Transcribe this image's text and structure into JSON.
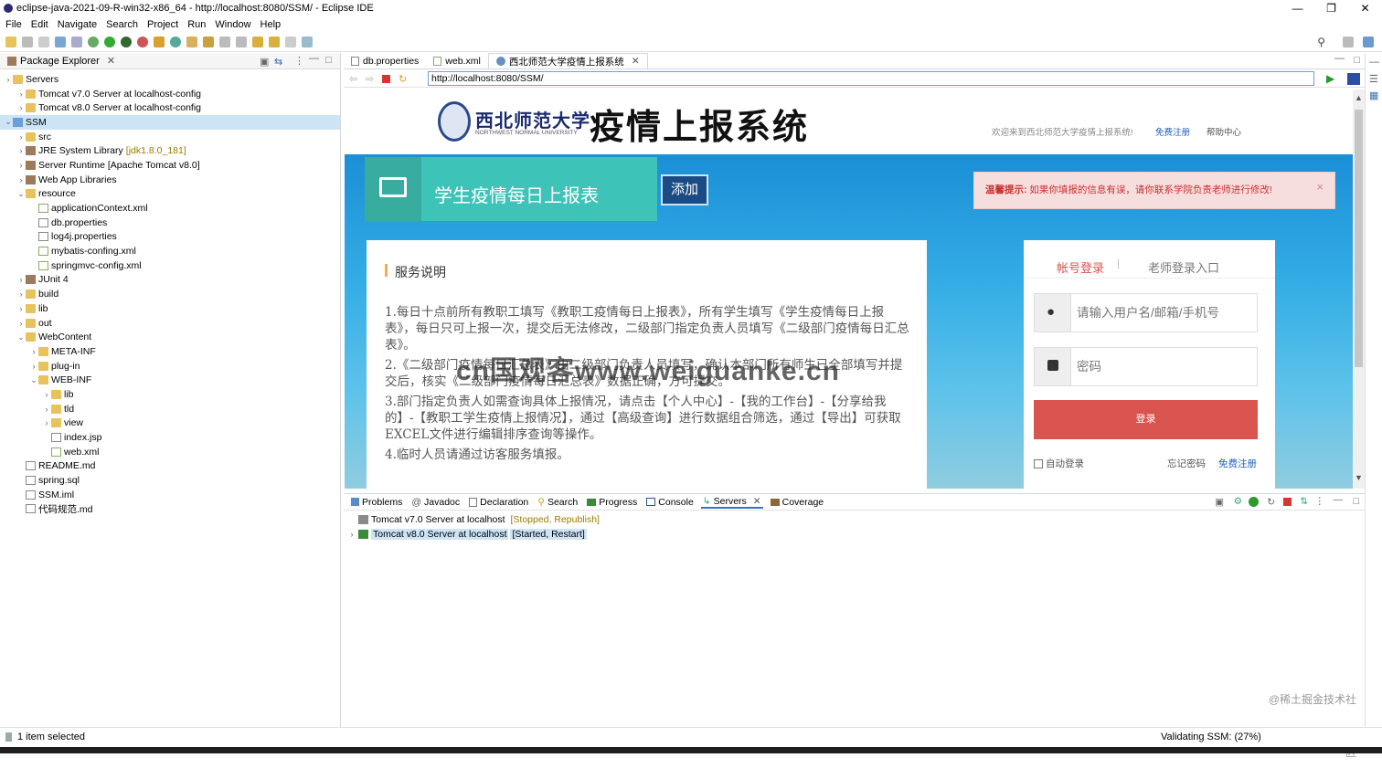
{
  "window": {
    "title": "eclipse-java-2021-09-R-win32-x86_64 - http://localhost:8080/SSM/ - Eclipse IDE"
  },
  "menu": [
    "File",
    "Edit",
    "Navigate",
    "Search",
    "Project",
    "Run",
    "Window",
    "Help"
  ],
  "package_explorer": {
    "title": "Package Explorer",
    "items": [
      {
        "label": "Servers",
        "deco": ""
      },
      {
        "label": "Tomcat v7.0 Server at localhost-config",
        "deco": ""
      },
      {
        "label": "Tomcat v8.0 Server at localhost-config",
        "deco": ""
      },
      {
        "label": "SSM",
        "deco": ""
      },
      {
        "label": "src",
        "deco": ""
      },
      {
        "label": "JRE System Library",
        "deco": "[jdk1.8.0_181]"
      },
      {
        "label": "Server Runtime [Apache Tomcat v8.0]",
        "deco": ""
      },
      {
        "label": "Web App Libraries",
        "deco": ""
      },
      {
        "label": "resource",
        "deco": ""
      },
      {
        "label": "applicationContext.xml",
        "deco": ""
      },
      {
        "label": "db.properties",
        "deco": ""
      },
      {
        "label": "log4j.properties",
        "deco": ""
      },
      {
        "label": "mybatis-confing.xml",
        "deco": ""
      },
      {
        "label": "springmvc-config.xml",
        "deco": ""
      },
      {
        "label": "JUnit 4",
        "deco": ""
      },
      {
        "label": "build",
        "deco": ""
      },
      {
        "label": "lib",
        "deco": ""
      },
      {
        "label": "out",
        "deco": ""
      },
      {
        "label": "WebContent",
        "deco": ""
      },
      {
        "label": "META-INF",
        "deco": ""
      },
      {
        "label": "plug-in",
        "deco": ""
      },
      {
        "label": "WEB-INF",
        "deco": ""
      },
      {
        "label": "lib",
        "deco": ""
      },
      {
        "label": "tld",
        "deco": ""
      },
      {
        "label": "view",
        "deco": ""
      },
      {
        "label": "index.jsp",
        "deco": ""
      },
      {
        "label": "web.xml",
        "deco": ""
      },
      {
        "label": "README.md",
        "deco": ""
      },
      {
        "label": "spring.sql",
        "deco": ""
      },
      {
        "label": "SSM.iml",
        "deco": ""
      },
      {
        "label": "代码规范.md",
        "deco": ""
      }
    ]
  },
  "editor": {
    "tabs": [
      "db.properties",
      "web.xml",
      "西北师范大学疫情上报系统"
    ],
    "url": "http://localhost:8080/SSM/"
  },
  "web": {
    "univ_cn": "西北师范大学",
    "univ_en": "NORTHWEST NORMAL UNIVERSITY",
    "sys_title": "疫情上报系统",
    "welcome": "欢迎来到西北师范大学疫情上报系统!",
    "register": "免费注册",
    "help": "帮助中心",
    "banner_title": "学生疫情每日上报表",
    "add_btn": "添加",
    "tip_label": "温馨提示:",
    "tip_text": "如果你填报的信息有误，请你联系学院负责老师进行修改!",
    "service_title": "服务说明",
    "service_items": [
      "1.每日十点前所有教职工填写《教职工疫情每日上报表》，所有学生填写《学生疫情每日上报表》，每日只可上报一次，提交后无法修改，二级部门指定负责人员填写《二级部门疫情每日汇总表》。",
      "2.《二级部门疫情每日汇总表》由二级部门负责人员填写，确认本部门所有师生已全部填写并提交后，核实《二级部门疫情每日汇总表》数据正确，方可提交。",
      "3.部门指定负责人如需查询具体上报情况，请点击【个人中心】-【我的工作台】-【分享给我的】-【教职工学生疫情上报情况】，通过【高级查询】进行数据组合筛选，通过【导出】可获取EXCEL文件进行编辑排序查询等操作。",
      "4.临时人员请通过访客服务填报。"
    ],
    "login_tab": "帐号登录",
    "teacher_tab": "老师登录入口",
    "user_ph": "请输入用户名/邮箱/手机号",
    "pwd_ph": "密码",
    "login_btn": "登录",
    "auto_login": "自动登录",
    "forgot": "忘记密码",
    "free_reg": "免费注册",
    "watermark": "cn国观客www.weiguanke.cn"
  },
  "bottom": {
    "tabs": [
      "Problems",
      "Javadoc",
      "Declaration",
      "Search",
      "Progress",
      "Console",
      "Servers",
      "Coverage"
    ],
    "servers": [
      {
        "name": "Tomcat v7.0 Server at localhost",
        "state": "[Stopped, Republish]"
      },
      {
        "name": "Tomcat v8.0 Server at localhost",
        "state": "[Started, Restart]"
      }
    ]
  },
  "status": {
    "left": "1 item selected",
    "right": "Validating SSM: (27%)"
  },
  "corner_watermark": "@稀土掘金技术社区",
  "colors": {
    "accent": "#3b73b9",
    "teal": "#3ec3b8",
    "red": "#d9534f",
    "hero": "#2aa2df"
  }
}
